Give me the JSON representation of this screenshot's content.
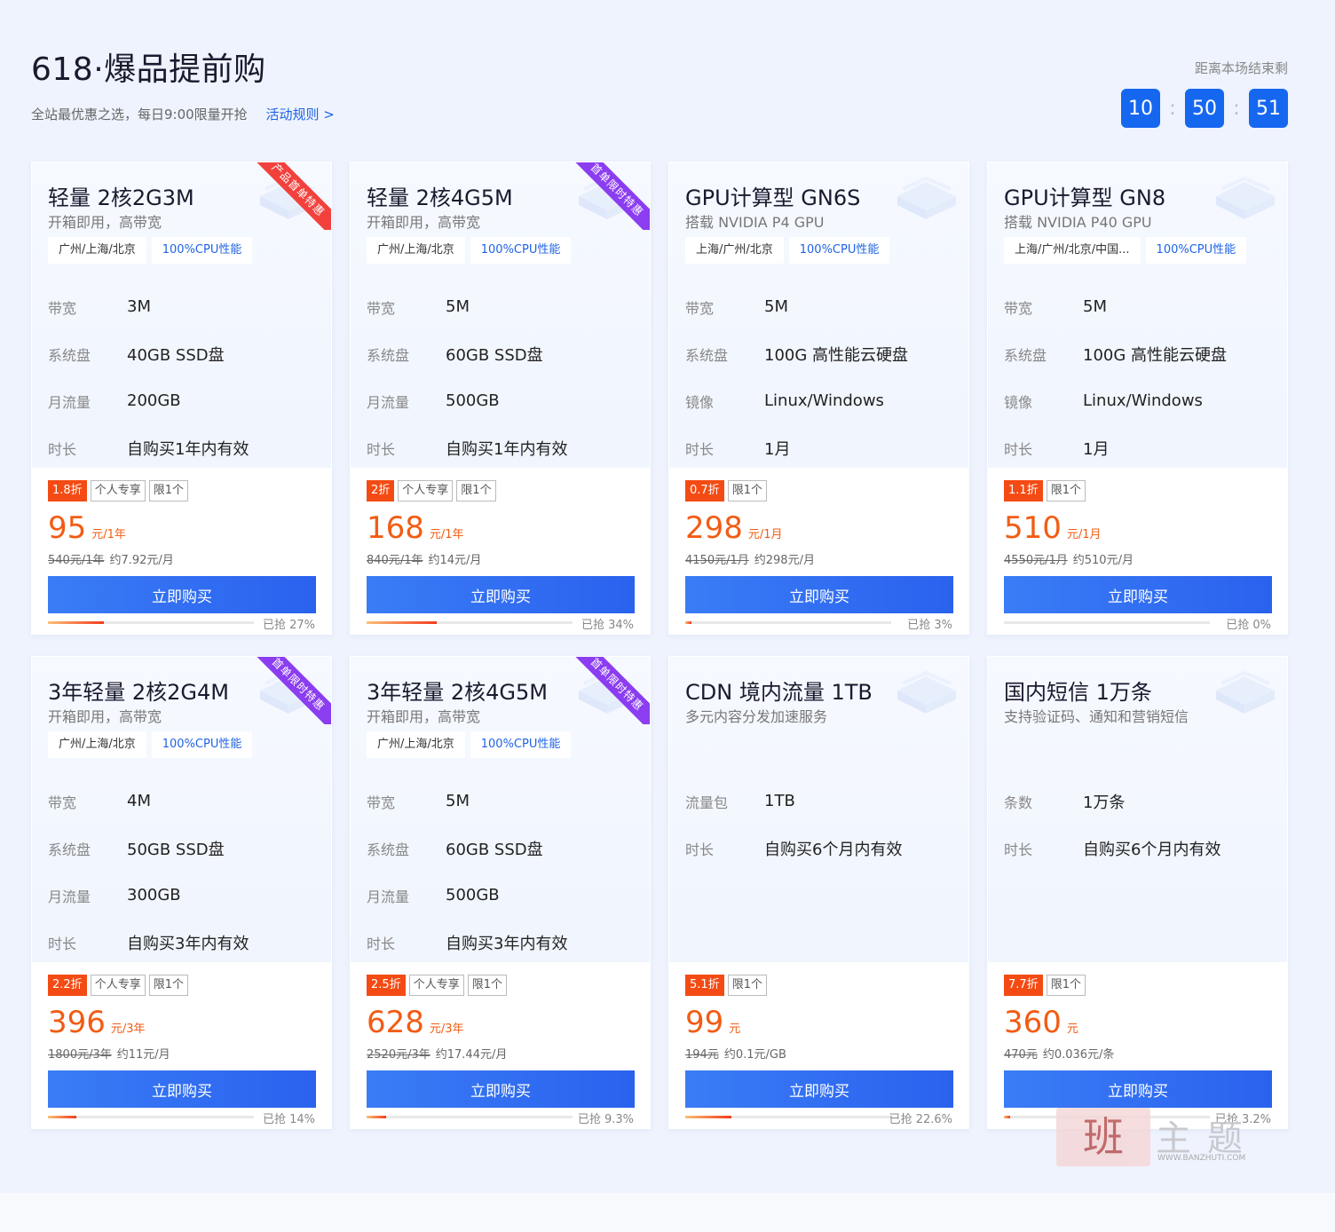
{
  "header": {
    "title": "618·爆品提前购",
    "subtitle": "全站最优惠之选，每日9:00限量开抢",
    "rules_link": "活动规则 >",
    "countdown_label": "距离本场结束剩",
    "countdown": {
      "h": "10",
      "sep1": ":",
      "m": "50",
      "sep2": ":",
      "s": "51"
    }
  },
  "buy_label": "立即购买",
  "colors": {
    "accent": "#1667f0",
    "price": "#f25c14",
    "discount": "#f44b14",
    "ribbon_red": "#f2413c",
    "ribbon_purple": "#8b3df0"
  },
  "cards": [
    {
      "title": "轻量 2核2G3M",
      "desc": "开箱即用，高带宽",
      "ribbon": "产品首单特惠",
      "tags": [
        "广州/上海/北京",
        "100%CPU性能"
      ],
      "specs": [
        {
          "k": "带宽",
          "v": "3M"
        },
        {
          "k": "系统盘",
          "v": "40GB SSD盘"
        },
        {
          "k": "月流量",
          "v": "200GB"
        },
        {
          "k": "时长",
          "v": "自购买1年内有效"
        }
      ],
      "badges": [
        "1.8折",
        "个人专享",
        "限1个"
      ],
      "price": "95",
      "unit": "元/1年",
      "orig": "540元/1年",
      "avg": "约7.92元/月",
      "progress_text": "已抢 27%",
      "progress": 0.27
    },
    {
      "title": "轻量 2核4G5M",
      "desc": "开箱即用，高带宽",
      "ribbon": "首单限时特惠",
      "tags": [
        "广州/上海/北京",
        "100%CPU性能"
      ],
      "specs": [
        {
          "k": "带宽",
          "v": "5M"
        },
        {
          "k": "系统盘",
          "v": "60GB SSD盘"
        },
        {
          "k": "月流量",
          "v": "500GB"
        },
        {
          "k": "时长",
          "v": "自购买1年内有效"
        }
      ],
      "badges": [
        "2折",
        "个人专享",
        "限1个"
      ],
      "price": "168",
      "unit": "元/1年",
      "orig": "840元/1年",
      "avg": "约14元/月",
      "progress_text": "已抢 34%",
      "progress": 0.34
    },
    {
      "title": "GPU计算型 GN6S",
      "desc": "搭载 NVIDIA P4 GPU",
      "ribbon": "",
      "tags": [
        "上海/广州/北京",
        "100%CPU性能"
      ],
      "specs": [
        {
          "k": "带宽",
          "v": "5M"
        },
        {
          "k": "系统盘",
          "v": "100G 高性能云硬盘"
        },
        {
          "k": "镜像",
          "v": "Linux/Windows"
        },
        {
          "k": "时长",
          "v": "1月"
        }
      ],
      "badges": [
        "0.7折",
        "限1个"
      ],
      "price": "298",
      "unit": "元/1月",
      "orig": "4150元/1月",
      "avg": "约298元/月",
      "progress_text": "已抢 3%",
      "progress": 0.03
    },
    {
      "title": "GPU计算型 GN8",
      "desc": "搭载 NVIDIA P40 GPU",
      "ribbon": "",
      "tags": [
        "上海/广州/北京/中国...",
        "100%CPU性能"
      ],
      "specs": [
        {
          "k": "带宽",
          "v": "5M"
        },
        {
          "k": "系统盘",
          "v": "100G 高性能云硬盘"
        },
        {
          "k": "镜像",
          "v": "Linux/Windows"
        },
        {
          "k": "时长",
          "v": "1月"
        }
      ],
      "badges": [
        "1.1折",
        "限1个"
      ],
      "price": "510",
      "unit": "元/1月",
      "orig": "4550元/1月",
      "avg": "约510元/月",
      "progress_text": "已抢 0%",
      "progress": 0
    },
    {
      "title": "3年轻量 2核2G4M",
      "desc": "开箱即用，高带宽",
      "ribbon": "首单限时特惠",
      "tags": [
        "广州/上海/北京",
        "100%CPU性能"
      ],
      "specs": [
        {
          "k": "带宽",
          "v": "4M"
        },
        {
          "k": "系统盘",
          "v": "50GB SSD盘"
        },
        {
          "k": "月流量",
          "v": "300GB"
        },
        {
          "k": "时长",
          "v": "自购买3年内有效"
        }
      ],
      "badges": [
        "2.2折",
        "个人专享",
        "限1个"
      ],
      "price": "396",
      "unit": "元/3年",
      "orig": "1800元/3年",
      "avg": "约11元/月",
      "progress_text": "已抢 14%",
      "progress": 0.14
    },
    {
      "title": "3年轻量 2核4G5M",
      "desc": "开箱即用，高带宽",
      "ribbon": "首单限时特惠",
      "tags": [
        "广州/上海/北京",
        "100%CPU性能"
      ],
      "specs": [
        {
          "k": "带宽",
          "v": "5M"
        },
        {
          "k": "系统盘",
          "v": "60GB SSD盘"
        },
        {
          "k": "月流量",
          "v": "500GB"
        },
        {
          "k": "时长",
          "v": "自购买3年内有效"
        }
      ],
      "badges": [
        "2.5折",
        "个人专享",
        "限1个"
      ],
      "price": "628",
      "unit": "元/3年",
      "orig": "2520元/3年",
      "avg": "约17.44元/月",
      "progress_text": "已抢 9.3%",
      "progress": 0.093
    },
    {
      "title": "CDN 境内流量 1TB",
      "desc": "多元内容分发加速服务",
      "ribbon": "",
      "tags": [],
      "specs": [
        {
          "k": "流量包",
          "v": "1TB"
        },
        {
          "k": "时长",
          "v": "自购买6个月内有效"
        }
      ],
      "badges": [
        "5.1折",
        "限1个"
      ],
      "price": "99",
      "unit": "元",
      "orig": "194元",
      "avg": "约0.1元/GB",
      "progress_text": "已抢 22.6%",
      "progress": 0.226
    },
    {
      "title": "国内短信 1万条",
      "desc": "支持验证码、通知和营销短信",
      "ribbon": "",
      "tags": [],
      "specs": [
        {
          "k": "条数",
          "v": "1万条"
        },
        {
          "k": "时长",
          "v": "自购买6个月内有效"
        }
      ],
      "badges": [
        "7.7折",
        "限1个"
      ],
      "price": "360",
      "unit": "元",
      "orig": "470元",
      "avg": "约0.036元/条",
      "progress_text": "已抢 3.2%",
      "progress": 0.032
    }
  ],
  "watermark": {
    "seal": "班",
    "text": "主题",
    "url": "WWW.BANZHUTI.COM"
  }
}
